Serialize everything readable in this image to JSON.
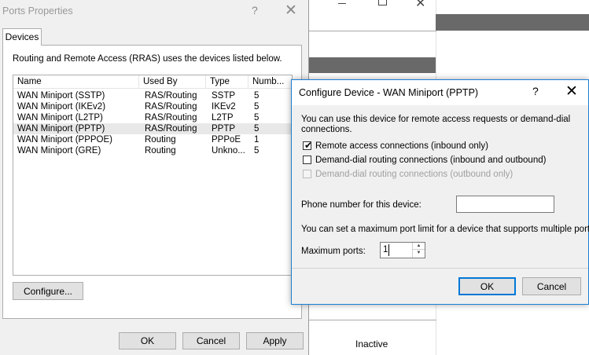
{
  "background_window": {
    "status_text": "Inactive"
  },
  "ports_dialog": {
    "title": "Ports Properties",
    "help_glyph": "?",
    "close_glyph": "✕",
    "tab_label": "Devices",
    "description": "Routing and Remote Access (RRAS) uses the devices listed below.",
    "columns": [
      "Name",
      "Used By",
      "Type",
      "Numb..."
    ],
    "rows": [
      {
        "name": "WAN Miniport (SSTP)",
        "used_by": "RAS/Routing",
        "type": "SSTP",
        "number": "5"
      },
      {
        "name": "WAN Miniport (IKEv2)",
        "used_by": "RAS/Routing",
        "type": "IKEv2",
        "number": "5"
      },
      {
        "name": "WAN Miniport (L2TP)",
        "used_by": "RAS/Routing",
        "type": "L2TP",
        "number": "5"
      },
      {
        "name": "WAN Miniport (PPTP)",
        "used_by": "RAS/Routing",
        "type": "PPTP",
        "number": "5"
      },
      {
        "name": "WAN Miniport (PPPOE)",
        "used_by": "Routing",
        "type": "PPPoE",
        "number": "1"
      },
      {
        "name": "WAN Miniport (GRE)",
        "used_by": "Routing",
        "type": "Unkno...",
        "number": "5"
      }
    ],
    "selected_row_index": 3,
    "configure_button": "Configure...",
    "ok_button": "OK",
    "cancel_button": "Cancel",
    "apply_button": "Apply"
  },
  "configure_dialog": {
    "title": "Configure Device - WAN Miniport (PPTP)",
    "help_glyph": "?",
    "close_glyph": "✕",
    "description": "You can use this device for remote access requests or demand-dial connections.",
    "checkboxes": [
      {
        "label": "Remote access connections (inbound only)",
        "checked": true,
        "enabled": true
      },
      {
        "label": "Demand-dial routing connections (inbound and outbound)",
        "checked": false,
        "enabled": true
      },
      {
        "label": "Demand-dial routing connections (outbound only)",
        "checked": false,
        "enabled": false
      }
    ],
    "phone_label": "Phone number for this device:",
    "phone_value": "",
    "port_limit_text": "You can set a maximum port limit for a device that supports multiple ports.",
    "max_ports_label": "Maximum ports:",
    "max_ports_value": "1",
    "ok_button": "OK",
    "cancel_button": "Cancel"
  },
  "colors": {
    "dialog_bg": "#f0f0f0",
    "active_border": "#1a7fd4",
    "default_button_border": "#0078d7",
    "background_bar": "#696969"
  }
}
